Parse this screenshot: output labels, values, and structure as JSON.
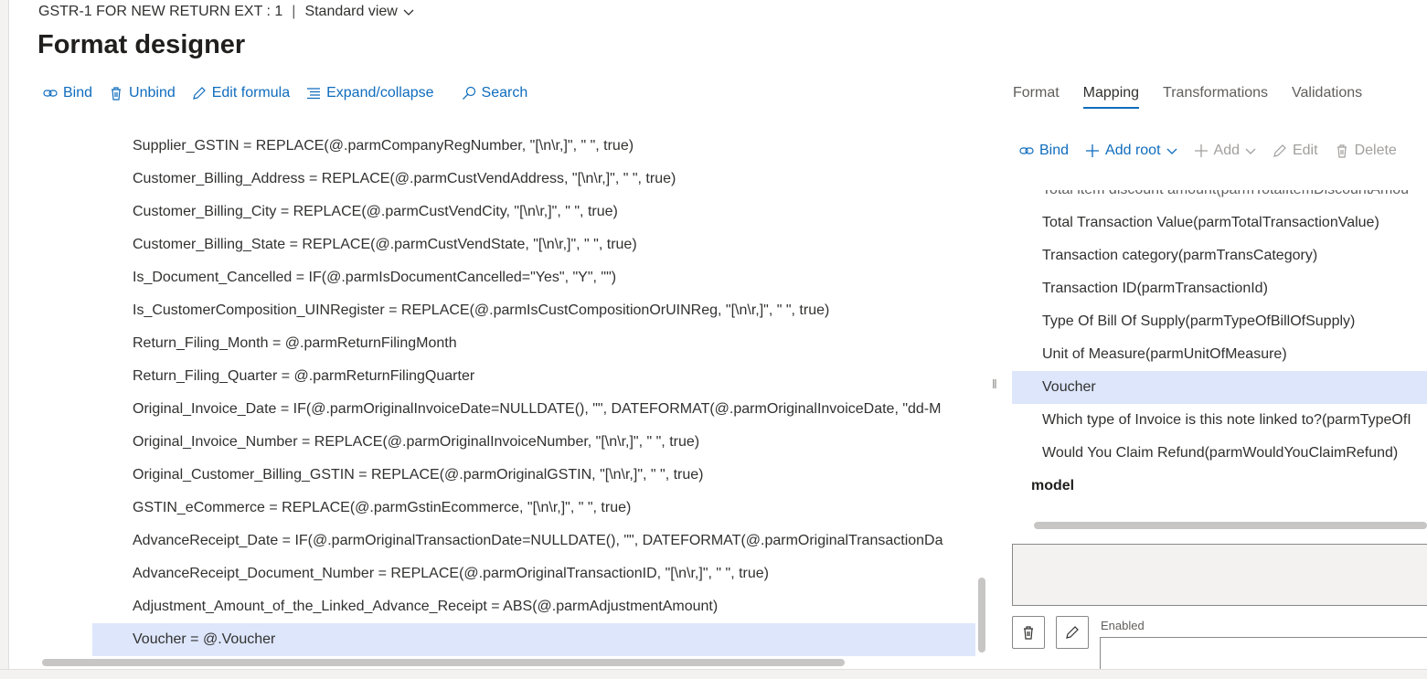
{
  "breadcrumb": {
    "entity": "GSTR-1 FOR NEW RETURN EXT : 1",
    "separator": "|",
    "view": "Standard view"
  },
  "page_title": "Format designer",
  "toolbar": {
    "bind": "Bind",
    "unbind": "Unbind",
    "edit_formula": "Edit formula",
    "expand_collapse": "Expand/collapse",
    "search": "Search"
  },
  "tabs": [
    "Format",
    "Mapping",
    "Transformations",
    "Validations"
  ],
  "active_tab": "Mapping",
  "formulas": [
    "Supplier_GSTIN = REPLACE(@.parmCompanyRegNumber, \"[\\n\\r,]\", \" \", true)",
    "Customer_Billing_Address = REPLACE(@.parmCustVendAddress, \"[\\n\\r,]\", \" \", true)",
    "Customer_Billing_City = REPLACE(@.parmCustVendCity, \"[\\n\\r,]\", \" \", true)",
    "Customer_Billing_State = REPLACE(@.parmCustVendState, \"[\\n\\r,]\", \" \", true)",
    "Is_Document_Cancelled = IF(@.parmIsDocumentCancelled=\"Yes\", \"Y\", \"\")",
    "Is_CustomerComposition_UINRegister = REPLACE(@.parmIsCustCompositionOrUINReg, \"[\\n\\r,]\", \" \", true)",
    "Return_Filing_Month = @.parmReturnFilingMonth",
    "Return_Filing_Quarter = @.parmReturnFilingQuarter",
    "Original_Invoice_Date = IF(@.parmOriginalInvoiceDate=NULLDATE(), \"\", DATEFORMAT(@.parmOriginalInvoiceDate, \"dd-M",
    "Original_Invoice_Number = REPLACE(@.parmOriginalInvoiceNumber, \"[\\n\\r,]\", \" \", true)",
    "Original_Customer_Billing_GSTIN = REPLACE(@.parmOriginalGSTIN, \"[\\n\\r,]\", \" \", true)",
    "GSTIN_eCommerce = REPLACE(@.parmGstinEcommerce, \"[\\n\\r,]\", \" \", true)",
    "AdvanceReceipt_Date = IF(@.parmOriginalTransactionDate=NULLDATE(), \"\", DATEFORMAT(@.parmOriginalTransactionDa",
    "AdvanceReceipt_Document_Number = REPLACE(@.parmOriginalTransactionID, \"[\\n\\r,]\", \" \", true)",
    "Adjustment_Amount_of_the_Linked_Advance_Receipt = ABS(@.parmAdjustmentAmount)",
    "Voucher = @.Voucher"
  ],
  "selected_formula": "Voucher = @.Voucher",
  "mapping_toolbar": {
    "bind": "Bind",
    "add_root": "Add root",
    "add": "Add",
    "edit": "Edit",
    "delete": "Delete"
  },
  "mapping_items": [
    "Total item discount amount(parmTotalItemDiscountAmou",
    "Total Transaction Value(parmTotalTransactionValue)",
    "Transaction category(parmTransCategory)",
    "Transaction ID(parmTransactionId)",
    "Type Of Bill Of Supply(parmTypeOfBillOfSupply)",
    "Unit of Measure(parmUnitOfMeasure)",
    "Voucher",
    "Which type of Invoice is this note linked to?(parmTypeOfI",
    "Would You Claim Refund(parmWouldYouClaimRefund)"
  ],
  "selected_mapping": "Voucher",
  "mapping_root": "model",
  "enabled_label": "Enabled",
  "colors": {
    "accent": "#0f6cbd",
    "selection": "#dde6fb",
    "disabled": "#a19f9d"
  }
}
